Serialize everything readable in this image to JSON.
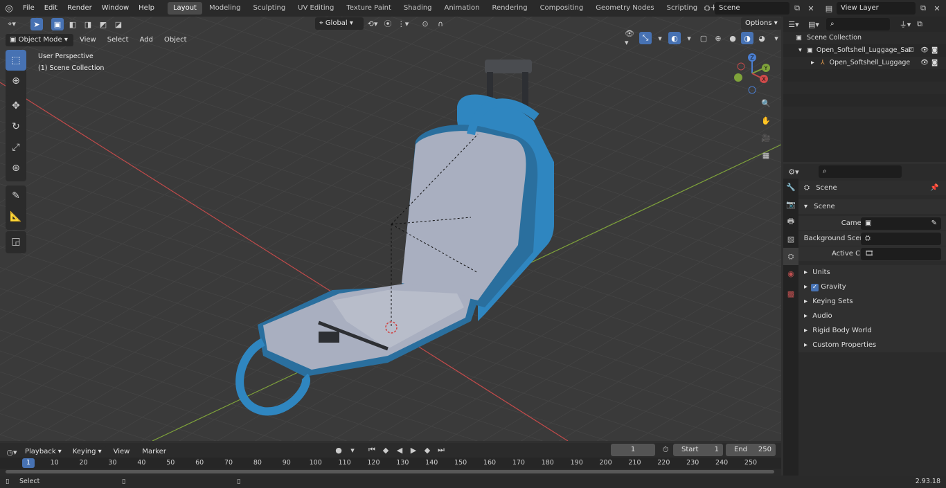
{
  "topbar": {
    "menus": [
      "File",
      "Edit",
      "Render",
      "Window",
      "Help"
    ],
    "workspaces": [
      "Layout",
      "Modeling",
      "Sculpting",
      "UV Editing",
      "Texture Paint",
      "Shading",
      "Animation",
      "Rendering",
      "Compositing",
      "Geometry Nodes",
      "Scripting"
    ],
    "active_workspace": "Layout",
    "add_tab": "+",
    "scene": "Scene",
    "view_layer": "View Layer"
  },
  "viewport_header": {
    "transform_orientation": "Global",
    "options": "Options",
    "mode": "Object Mode",
    "menus": [
      "View",
      "Select",
      "Add",
      "Object"
    ]
  },
  "viewport": {
    "perspective_label": "User Perspective",
    "collection_label": "(1) Scene Collection",
    "gizmo_axes": {
      "z": "Z",
      "y": "Y",
      "x": "X"
    }
  },
  "outliner": {
    "root": "Scene Collection",
    "items": [
      {
        "name": "Open_Softshell_Luggage_Sar",
        "level": 1
      },
      {
        "name": "Open_Softshell_Luggage",
        "level": 2
      }
    ]
  },
  "properties": {
    "header": "Scene",
    "panel": "Scene",
    "fields": [
      {
        "label": "Camera",
        "value": ""
      },
      {
        "label": "Background Scene",
        "value": ""
      },
      {
        "label": "Active Clip",
        "value": ""
      }
    ],
    "sections": [
      "Units",
      "Gravity",
      "Keying Sets",
      "Audio",
      "Rigid Body World",
      "Custom Properties"
    ],
    "gravity_checked": true
  },
  "timeline": {
    "menus": [
      "Playback",
      "Keying",
      "View",
      "Marker"
    ],
    "current_frame": "1",
    "start_label": "Start",
    "start": "1",
    "end_label": "End",
    "end": "250",
    "ticks": [
      "1",
      "10",
      "20",
      "30",
      "40",
      "50",
      "60",
      "70",
      "80",
      "90",
      "100",
      "110",
      "120",
      "130",
      "140",
      "150",
      "160",
      "170",
      "180",
      "190",
      "200",
      "210",
      "220",
      "230",
      "240",
      "250"
    ]
  },
  "statusbar": {
    "left": "Select",
    "version": "2.93.18"
  },
  "colors": {
    "accent": "#4772b3",
    "luggage": "#2f86c0",
    "lining": "#a9afc0",
    "x_axis": "#c24a4a",
    "y_axis": "#7fa33a"
  }
}
